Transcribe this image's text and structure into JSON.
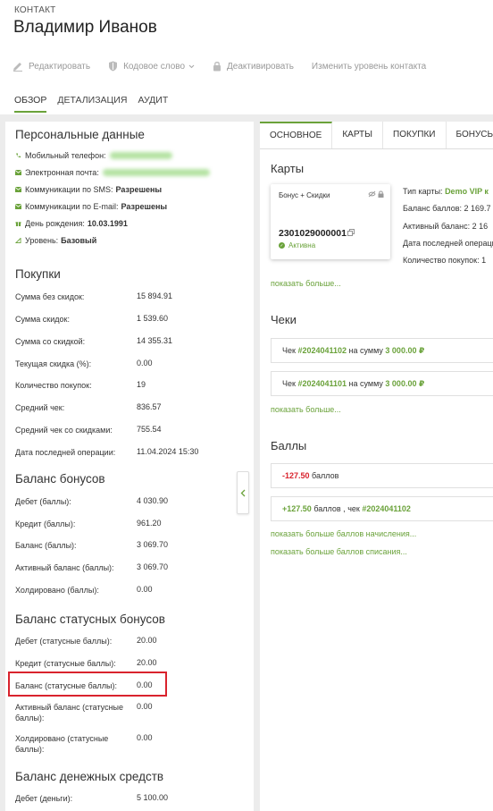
{
  "header": {
    "crumb": "КОНТАКТ",
    "title": "Владимир Иванов",
    "toolbar": [
      {
        "label": "Редактировать",
        "icon": "pencil-icon"
      },
      {
        "label": "Кодовое слово",
        "icon": "shield-icon"
      },
      {
        "label": "Деактивировать",
        "icon": "lock-icon"
      },
      {
        "label": "Изменить уровень контакта",
        "icon": ""
      }
    ],
    "tabs": [
      "ОБЗОР",
      "ДЕТАЛИЗАЦИЯ",
      "АУДИТ"
    ]
  },
  "personal": {
    "title": "Персональные данные",
    "phone_label": "Мобильный телефон:",
    "email_label": "Электронная почта:",
    "sms_label": "Коммуникации по SMS:",
    "sms_value": "Разрешены",
    "emailcomm_label": "Коммуникации по E-mail:",
    "emailcomm_value": "Разрешены",
    "birthday_label": "День рождения:",
    "birthday_value": "10.03.1991",
    "level_label": "Уровень:",
    "level_value": "Базовый"
  },
  "purchases": {
    "title": "Покупки",
    "rows": [
      {
        "label": "Сумма без скидок:",
        "value": "15 894.91"
      },
      {
        "label": "Сумма скидок:",
        "value": "1 539.60"
      },
      {
        "label": "Сумма со скидкой:",
        "value": "14 355.31"
      },
      {
        "label": "Текущая скидка (%):",
        "value": "0.00"
      },
      {
        "label": "Количество покупок:",
        "value": "19"
      },
      {
        "label": "Средний чек:",
        "value": "836.57"
      },
      {
        "label": "Средний чек со скидками:",
        "value": "755.54"
      },
      {
        "label": "Дата последней операции:",
        "value": "11.04.2024 15:30"
      }
    ]
  },
  "bonus": {
    "title": "Баланс бонусов",
    "rows": [
      {
        "label": "Дебет (баллы):",
        "value": "4 030.90"
      },
      {
        "label": "Кредит (баллы):",
        "value": "961.20"
      },
      {
        "label": "Баланс (баллы):",
        "value": "3 069.70"
      },
      {
        "label": "Активный баланс (баллы):",
        "value": "3 069.70"
      },
      {
        "label": "Холдировано (баллы):",
        "value": "0.00"
      }
    ]
  },
  "status_bonus": {
    "title": "Баланс статусных бонусов",
    "rows": [
      {
        "label": "Дебет (статусные баллы):",
        "value": "20.00"
      },
      {
        "label": "Кредит (статусные баллы):",
        "value": "20.00"
      },
      {
        "label": "Баланс (статусные баллы):",
        "value": "0.00"
      },
      {
        "label": "Активный баланс (статусные баллы):",
        "value": "0.00"
      },
      {
        "label": "Холдировано (статусные баллы):",
        "value": "0.00"
      }
    ]
  },
  "money": {
    "title": "Баланс денежных средств",
    "rows": [
      {
        "label": "Дебет (деньги):",
        "value": "5 100.00"
      }
    ]
  },
  "right": {
    "tabs": [
      "ОСНОВНОЕ",
      "КАРТЫ",
      "ПОКУПКИ",
      "БОНУСЫ"
    ],
    "cards_title": "Карты",
    "card": {
      "name": "Бонус + Скидки",
      "number": "2301029000001",
      "status": "Активна"
    },
    "card_info": [
      {
        "label": "Тип карты:",
        "value": "Demo VIP к"
      },
      {
        "label": "Баланс баллов:",
        "value": "2 169.7"
      },
      {
        "label": "Активный баланс:",
        "value": "2 16"
      },
      {
        "label": "Дата последней операци",
        "value": ""
      },
      {
        "label": "Количество покупок:",
        "value": "1"
      }
    ],
    "show_more": "показать больше...",
    "checks_title": "Чеки",
    "checks": [
      {
        "prefix": "Чек",
        "number": "#2024041102",
        "mid": "на сумму",
        "amount": "3 000.00 ₽"
      },
      {
        "prefix": "Чек",
        "number": "#2024041101",
        "mid": "на сумму",
        "amount": "3 000.00 ₽"
      }
    ],
    "points_title": "Баллы",
    "points": [
      {
        "amount": "-127.50",
        "text": "баллов",
        "check_text": "",
        "check": ""
      },
      {
        "amount": "+127.50",
        "text": "баллов ,",
        "check_text": "чек",
        "check": "#2024041102"
      }
    ],
    "more_accrual": "показать больше баллов начисления...",
    "more_writeoff": "показать больше баллов списания..."
  },
  "colors": {
    "accent": "#6aa23a",
    "highlight": "#d9232d"
  }
}
